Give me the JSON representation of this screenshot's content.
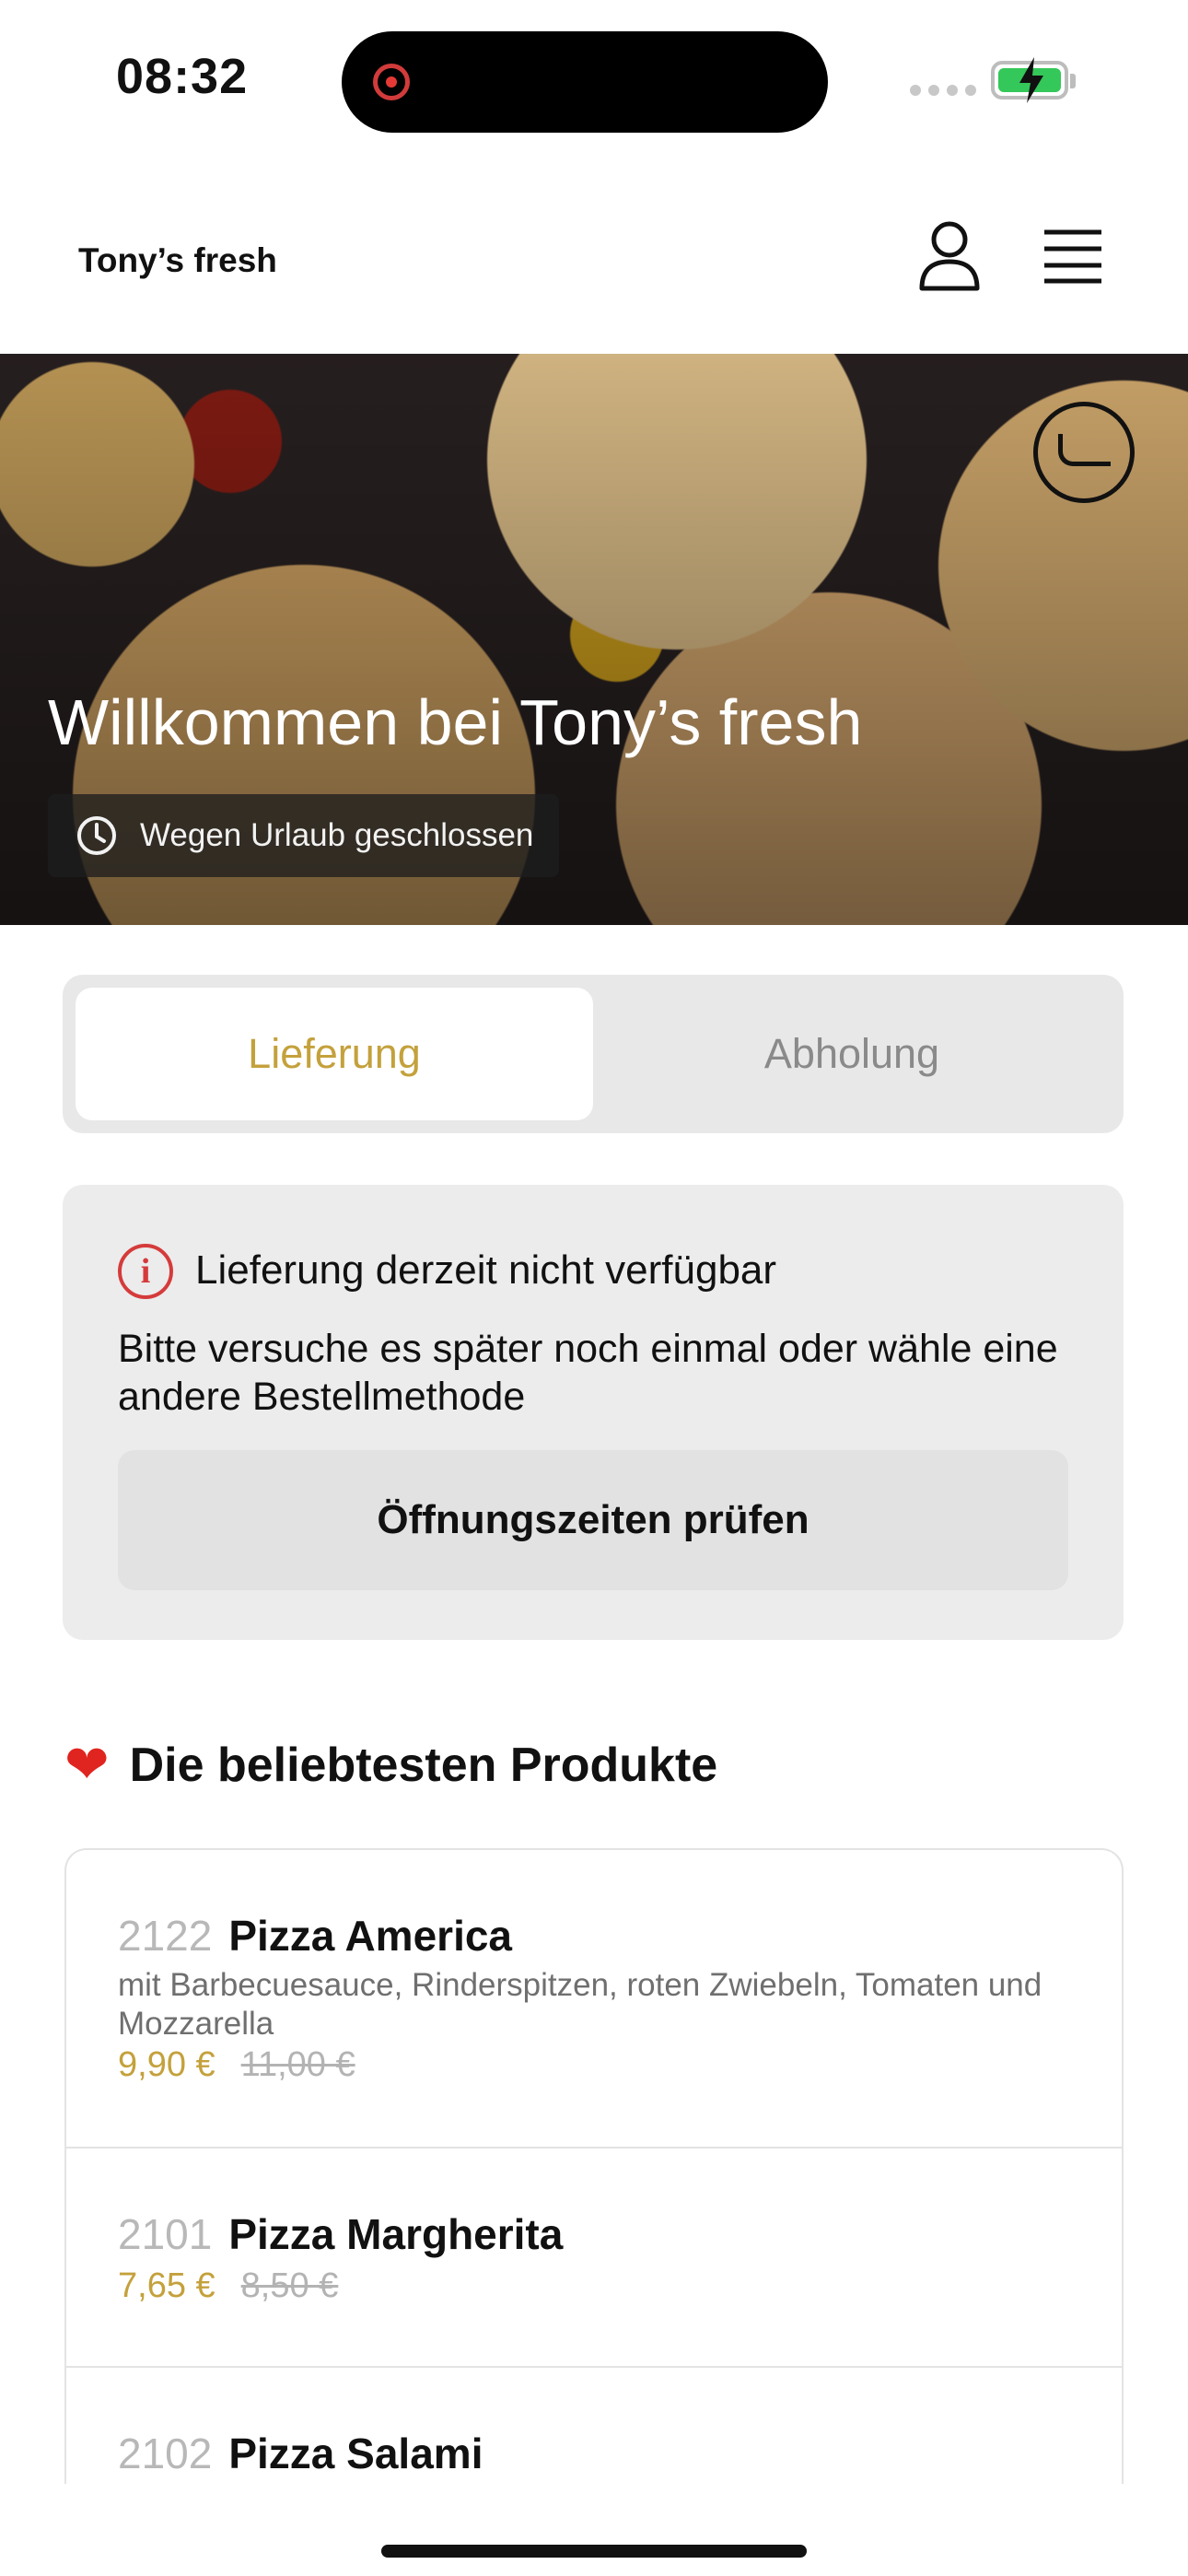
{
  "status_bar": {
    "time": "08:32",
    "battery_color": "#34c759",
    "recording_color": "#e53935"
  },
  "header": {
    "brand": "Tony’s fresh",
    "icons": [
      "user-icon",
      "menu-icon"
    ]
  },
  "hero": {
    "title": "Willkommen bei Tony’s fresh",
    "status": "Wegen Urlaub geschlossen",
    "status_icon": "clock-icon",
    "badge_icon": "halal-icon"
  },
  "order_mode": {
    "options": [
      {
        "label": "Lieferung",
        "selected": true
      },
      {
        "label": "Abholung",
        "selected": false
      }
    ],
    "accent_color": "#c4a13c"
  },
  "alert": {
    "icon": "info-icon",
    "title": "Lieferung derzeit nicht verfügbar",
    "message": "Bitte versuche es später noch einmal oder wähle eine andere Bestellmethode",
    "button": "Öffnungszeiten prüfen"
  },
  "popular": {
    "heading_icon": "heart-icon",
    "heading": "Die beliebtesten Produkte",
    "products": [
      {
        "number": "2122",
        "name": "Pizza America",
        "description": "mit Barbecuesauce, Rinderspitzen, roten Zwiebeln, Tomaten und Mozzarella",
        "price": "9,90 €",
        "old_price": "11,00 €"
      },
      {
        "number": "2101",
        "name": "Pizza Margherita",
        "description": "",
        "price": "7,65 €",
        "old_price": "8,50 €"
      },
      {
        "number": "2102",
        "name": "Pizza Salami"
      }
    ]
  }
}
